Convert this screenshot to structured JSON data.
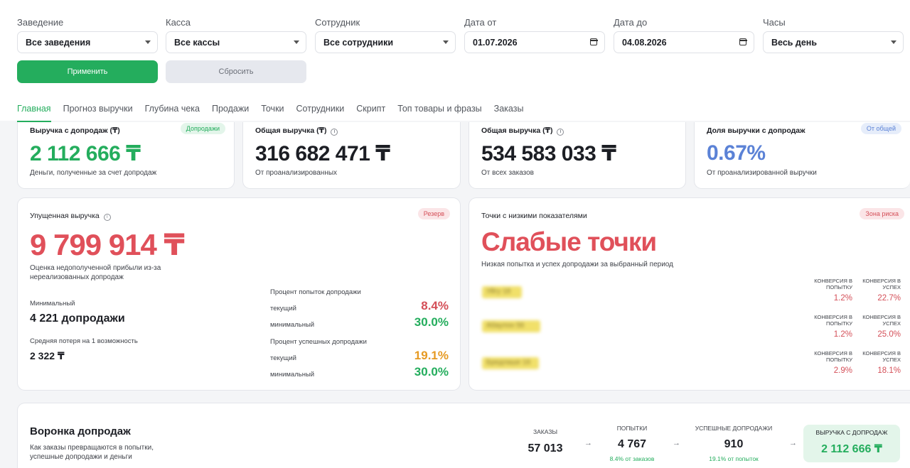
{
  "filters": {
    "venue": {
      "label": "Заведение",
      "value": "Все заведения"
    },
    "cashbox": {
      "label": "Касса",
      "value": "Все кассы"
    },
    "employee": {
      "label": "Сотрудник",
      "value": "Все сотрудники"
    },
    "date_from": {
      "label": "Дата от",
      "value": "01.07.2026"
    },
    "date_to": {
      "label": "Дата до",
      "value": "04.08.2026"
    },
    "hours": {
      "label": "Часы",
      "value": "Весь день"
    },
    "apply_label": "Применить",
    "reset_label": "Сбросить"
  },
  "tabs": [
    "Главная",
    "Прогноз выручки",
    "Глубина чека",
    "Продажи",
    "Точки",
    "Сотрудники",
    "Скрипт",
    "Топ товары и фразы",
    "Заказы"
  ],
  "active_tab": "Главная",
  "kpis": [
    {
      "title": "Выручка с допродаж (₸)",
      "value": "2 112 666 ₸",
      "sub": "Деньги, полученные за счет допродаж",
      "badge": "Допродажи",
      "color": "#24ad5d"
    },
    {
      "title": "Общая выручка (₸)",
      "value": "316 682 471 ₸",
      "sub": "От проанализированных",
      "color": "#1c1e24"
    },
    {
      "title": "Общая выручка (₸)",
      "value": "534 583 033 ₸",
      "sub": "От всех заказов",
      "color": "#1c1e24"
    },
    {
      "title": "Доля выручки с допродаж",
      "value": "0.67%",
      "sub": "От проанализированной выручки",
      "badge": "От общей",
      "color": "#5b82d6"
    }
  ],
  "lost": {
    "title": "Упущенная выручка",
    "badge": "Резерв",
    "value": "9 799 914 ₸",
    "desc_line1": "Оценка недополученной прибыли из-за",
    "desc_line2": "нереализованных допродаж",
    "min_label": "Минимальный",
    "min_value": "4 221 допродажи",
    "avg_label": "Средняя потеря на 1 возможность",
    "avg_value": "2 322 ₸",
    "attempts_title": "Процент попыток допродажи",
    "attempts_current_label": "текущий",
    "attempts_current": "8.4%",
    "attempts_min_label": "минимальный",
    "attempts_min": "30.0%",
    "success_title": "Процент успешных допродажи",
    "success_current_label": "текущий",
    "success_current": "19.1%",
    "success_min_label": "минимальный",
    "success_min": "30.0%"
  },
  "weak": {
    "title": "Точки с низкими показателями",
    "badge": "Зона риска",
    "headline": "Слабые точки",
    "sub": "Низкая попытка и успех допродажи за выбранный период",
    "col_attempt": "КОНВЕРСИЯ В ПОПЫТКУ",
    "col_success": "КОНВЕРСИЯ В УСПЕХ",
    "points": [
      {
        "name": "Уйгу 18",
        "attempt": "1.2%",
        "success": "22.7%"
      },
      {
        "name": "Абаулон 56",
        "attempt": "1.2%",
        "success": "25.0%"
      },
      {
        "name": "Бредлаше 16",
        "attempt": "2.9%",
        "success": "18.1%"
      }
    ]
  },
  "funnel": {
    "title": "Воронка допродаж",
    "sub_line1": "Как заказы превращаются в попытки,",
    "sub_line2": "успешные допродажи и деньги",
    "orders_label": "ЗАКАЗЫ",
    "orders_value": "57 013",
    "attempts_label": "ПОПЫТКИ",
    "attempts_value": "4 767",
    "attempts_sub": "8.4% от заказов",
    "success_label": "УСПЕШНЫЕ ДОПРОДАЖИ",
    "success_value": "910",
    "success_sub": "19.1% от попыток",
    "revenue_label": "ВЫРУЧКА С ДОПРОДАЖ",
    "revenue_value": "2 112 666 ₸",
    "arrow": "→"
  }
}
